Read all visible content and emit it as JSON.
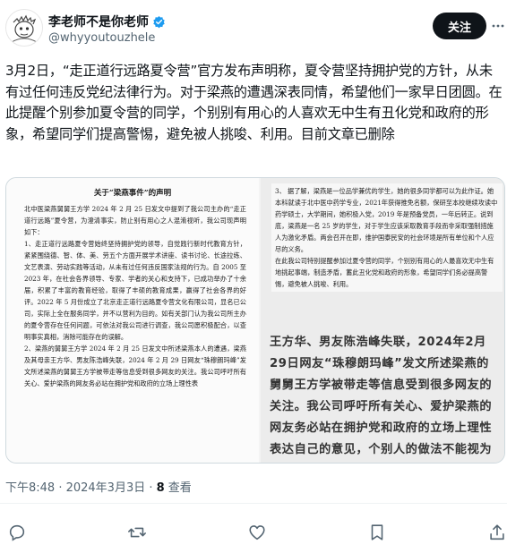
{
  "author": {
    "display_name": "李老师不是你老师",
    "handle": "@whyyoutouzhele",
    "avatar_icon": "avatar-cartoon-icon",
    "verified_color": "#1d9bf0"
  },
  "follow_label": "关注",
  "post": {
    "text": "3月2日，“走正道行远路夏令营”官方发布声明称，夏令营坚持拥护党的方针，从未有过任何违反党纪法律行为。对于梁燕的遭遇深表同情，希望他们一家早日团圆。在此提醒个别参加夏令营的同学，个别别有用心的人喜欢无中生有丑化党和政府的形象，希望同学们提高警惕，避免被人挑唆、利用。目前文章已删除"
  },
  "media": {
    "left": {
      "title": "关于“梁燕事件”的声明",
      "body": "北中医梁燕舅舅王方学 2024 年 2 月 25 日发文中提到了我公司主办的“走正道行远路”夏令营，为澄清事实，防止别有用心之人混淆视听，我公司现声明如下：\n1、走正道行远路夏令营始终坚持拥护党的领导，自觉践行新时代教育方针，紧紧围绕德、智、体、美、劳五个方面开展学术讲座、读书讨论、长途拉练、文艺表演、劳动实践等活动，从未有过任何违反国家法规的行为。自 2005 至 2023 年，在社会各界领导、专家、学者的关心和支持下，已成功举办了十余届，积累了丰富的教育经验，取得了丰硕的教育成果，赢得了社会各界的好评。2022 年 5 月份成立了北京走正道行远路夏令营文化有限公司，显名已公司，实际上全在服务同学，并不以营利为目的。如有关部门认为我公司所主办的夏令营存在任何问题，可依法对我公司进行调查，我公司愿积极配合，以查明事实真相，消除可能存在的误解。\n2、梁燕的舅舅王方学 2024 年 2 月 25 日发文中所述梁燕本人的遭遇，梁燕及其母亲王方华、男友陈浩峰失联，2024 年 2 月 29 日网友“珠穆朗玛峰”发文所述梁燕的舅舅王方学被带走等信息受到很多网友的关注。我公司呼吁所有关心、爱护梁燕的网友务必站在拥护党和政府的立场上理性表"
    },
    "right": {
      "top": "3、 据了解，梁燕是一位品学兼优的学生，她的很多同学都可以为此作证。她本科就读于北中医中药学专业，2021年获得推免名额，保研至本校继续攻读中药学硕士，大学期间，她积极入党，2019 年是预备党员，一年后转正。说到底，梁燕是一名 25 岁的学生，对于学生应该采取教育手段而非采取强制措施人为激化矛盾。两会召开在即，维护国泰民安的社会环境是所有单位和个人应尽的义务。\n在此我公司特别提醒参加过夏令营的同学，个别别有用心的人最喜欢无中生有地挑起事端，制造矛盾，蓄此丑化党和政府的形象，希望同学们务必提高警惕，避免被人挑唆、利用。",
      "zoom": "王方华、男友陈浩峰失联，2024年2月29日网友“珠穆朗玛峰”发文所述梁燕的舅舅王方学被带走等信息受到很多网友的关注。我公司呼吁所有关心、爱护梁燕的网友务必站在拥护党和政府的立场上理性表达自己的意见，个别人的做法不能视为整个单位的意志，切不可把个别等同一般。"
    }
  },
  "meta": {
    "time": "下午8:48 · 2024年3月3日 · ",
    "views_count": "8",
    "views_label": " 查看"
  },
  "actions": {
    "reply_icon": "reply-icon",
    "repost_icon": "repost-icon",
    "like_icon": "like-icon",
    "bookmark_icon": "bookmark-icon",
    "share_icon": "share-icon"
  }
}
